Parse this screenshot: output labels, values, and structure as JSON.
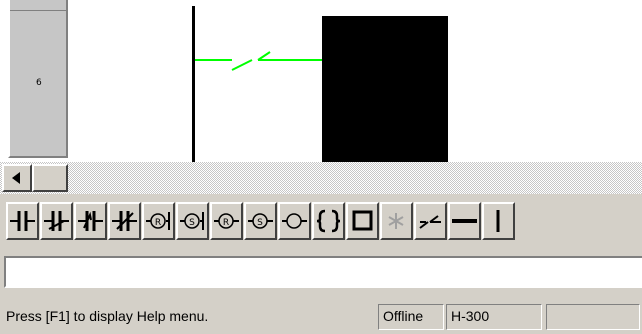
{
  "ladder": {
    "rung_number": "6"
  },
  "palette": {
    "tools": [
      {
        "icon": "normally-open-contact-icon"
      },
      {
        "icon": "normally-closed-contact-icon"
      },
      {
        "icon": "rising-edge-contact-icon"
      },
      {
        "icon": "falling-edge-contact-icon"
      },
      {
        "icon": "reset-coil-icon"
      },
      {
        "icon": "set-coil-icon"
      },
      {
        "icon": "reset-output-icon"
      },
      {
        "icon": "set-output-icon"
      },
      {
        "icon": "coil-output-icon"
      },
      {
        "icon": "function-block-icon"
      },
      {
        "icon": "box-instruction-icon"
      },
      {
        "icon": "delete-icon"
      },
      {
        "icon": "open-contact-line-icon"
      },
      {
        "icon": "horizontal-line-icon"
      },
      {
        "icon": "vertical-line-icon"
      }
    ]
  },
  "input_line": {
    "value": ""
  },
  "status_bar": {
    "help_text": "Press [F1] to display Help menu.",
    "mode": "Offline",
    "plc_type": "H-300",
    "extra": ""
  },
  "colors": {
    "wire": "#00ff00",
    "rail": "#000000",
    "panel": "#d4d0c8"
  }
}
